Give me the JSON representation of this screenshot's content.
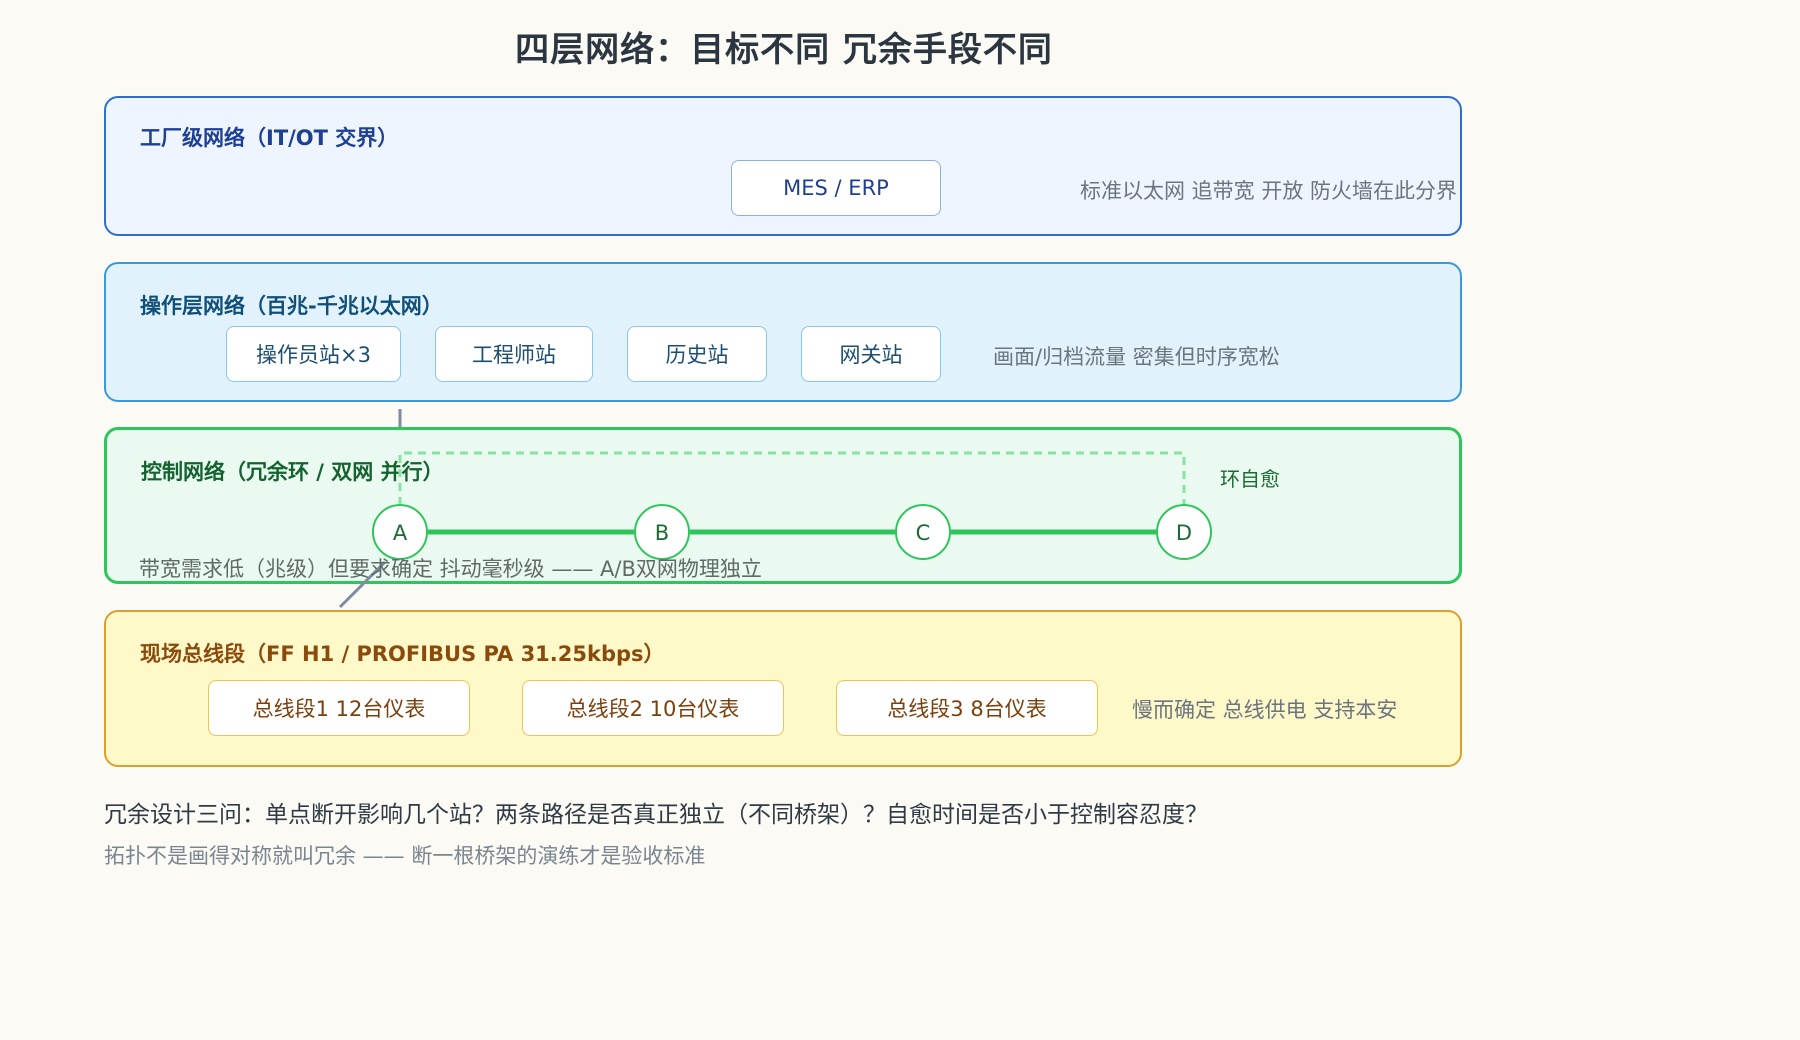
{
  "title": "四层网络：目标不同 冗余手段不同",
  "layers": {
    "plant": {
      "title": "工厂级网络（IT/OT 交界）",
      "boxes": [
        "MES / ERP"
      ],
      "note": "标准以太网 追带宽 开放 防火墙在此分界"
    },
    "ops": {
      "title": "操作层网络（百兆-千兆以太网）",
      "boxes": [
        "操作员站×3",
        "工程师站",
        "历史站",
        "网关站"
      ],
      "note": "画面/归档流量 密集但时序宽松"
    },
    "ctrl": {
      "title": "控制网络（冗余环 / 双网 并行）",
      "nodes": [
        "A",
        "B",
        "C",
        "D"
      ],
      "ring_note": "环自愈",
      "note": "带宽需求低（兆级）但要求确定 抖动毫秒级 —— A/B双网物理独立"
    },
    "field": {
      "title": "现场总线段（FF H1 / PROFIBUS PA 31.25kbps）",
      "boxes": [
        "总线段1 12台仪表",
        "总线段2 10台仪表",
        "总线段3 8台仪表"
      ],
      "note": "慢而确定 总线供电 支持本安"
    }
  },
  "footer": {
    "question": "冗余设计三问：单点断开影响几个站？两条路径是否真正独立（不同桥架）？自愈时间是否小于控制容忍度？",
    "summary": "拓扑不是画得对称就叫冗余 —— 断一根桥架的演练才是验收标准"
  },
  "colors": {
    "plant_border": "#2d6fcf",
    "ops_border": "#3a9ad8",
    "ctrl_border": "#2ec55d",
    "field_border": "#d9a12e",
    "ring_line": "#2ec55d",
    "dashed_ring": "#86e3a3",
    "uplink_line": "#7e8ba0"
  }
}
